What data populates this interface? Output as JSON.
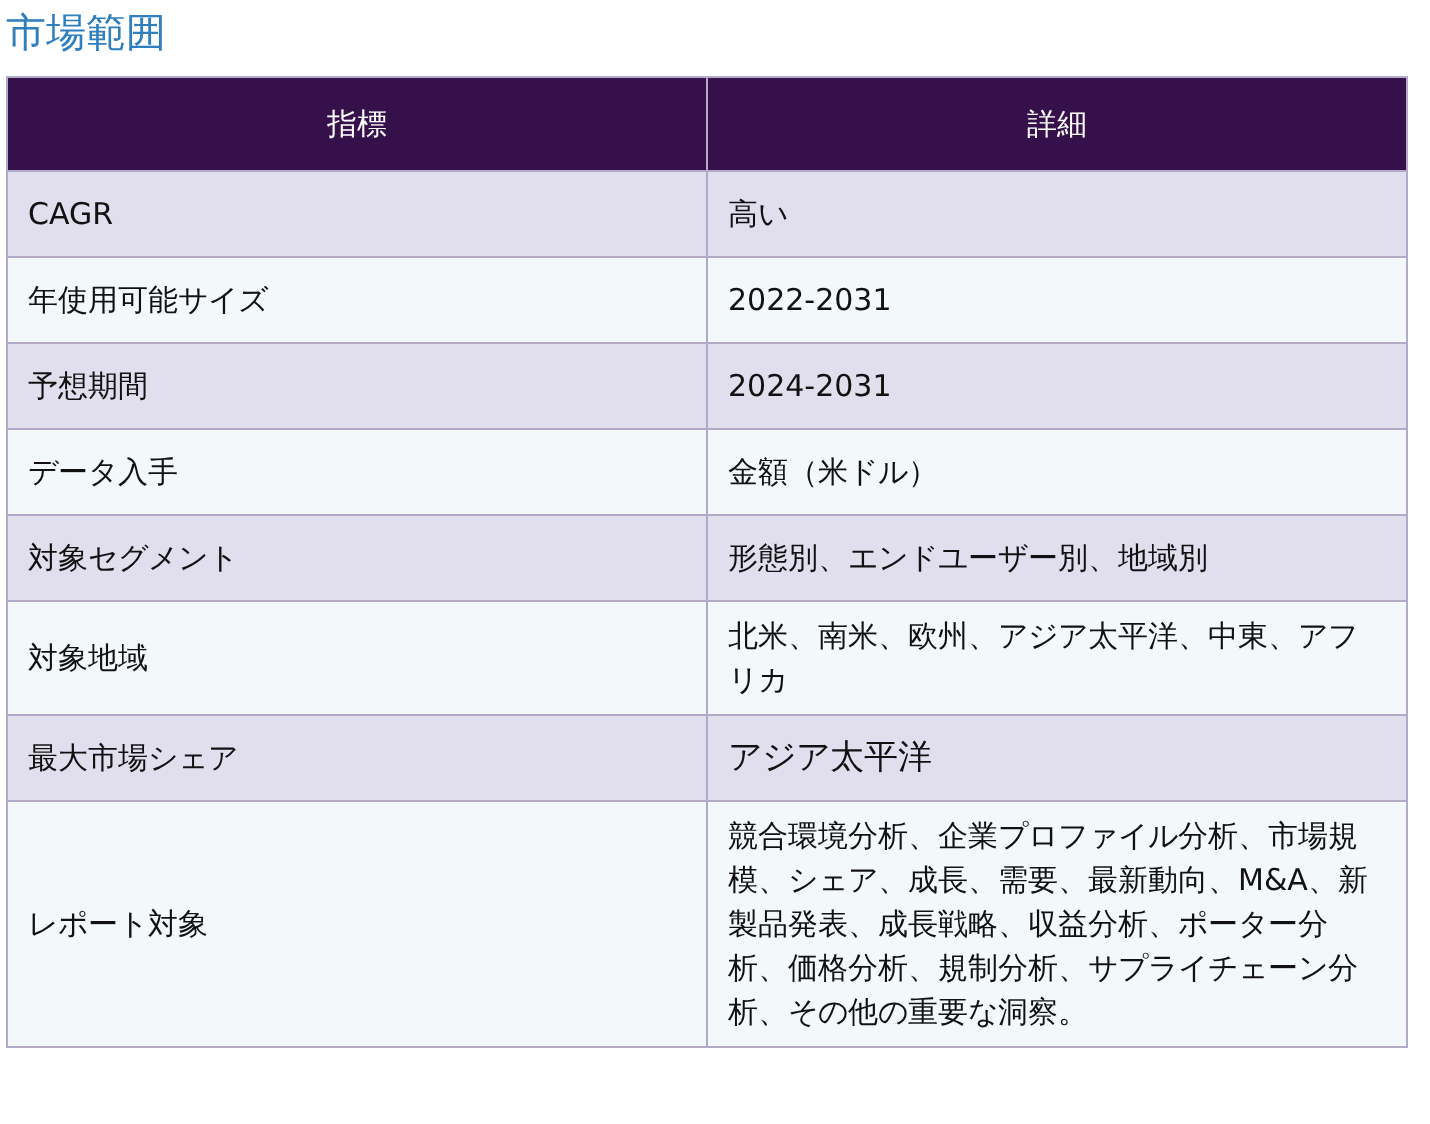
{
  "title": "市場範囲",
  "table": {
    "columns": [
      "指標",
      "詳細"
    ],
    "rows": [
      {
        "label": "CAGR",
        "value": "高い",
        "emphasized": false
      },
      {
        "label": "年使用可能サイズ",
        "value": "2022-2031",
        "emphasized": false
      },
      {
        "label": "予想期間",
        "value": "2024-2031",
        "emphasized": false
      },
      {
        "label": "データ入手",
        "value": "金額（米ドル）",
        "emphasized": false
      },
      {
        "label": "対象セグメント",
        "value": "形態別、エンドユーザー別、地域別",
        "emphasized": false
      },
      {
        "label": "対象地域",
        "value": "北米、南米、欧州、アジア太平洋、中東、アフリカ",
        "emphasized": false
      },
      {
        "label": "最大市場シェア",
        "value": "アジア太平洋",
        "emphasized": true
      },
      {
        "label": "レポート対象",
        "value": "競合環境分析、企業プロファイル分析、市場規模、シェア、成長、需要、最新動向、M&A、新製品発表、成長戦略、収益分析、ポーター分析、価格分析、規制分析、サプライチェーン分析、その他の重要な洞察。",
        "emphasized": false
      }
    ]
  }
}
